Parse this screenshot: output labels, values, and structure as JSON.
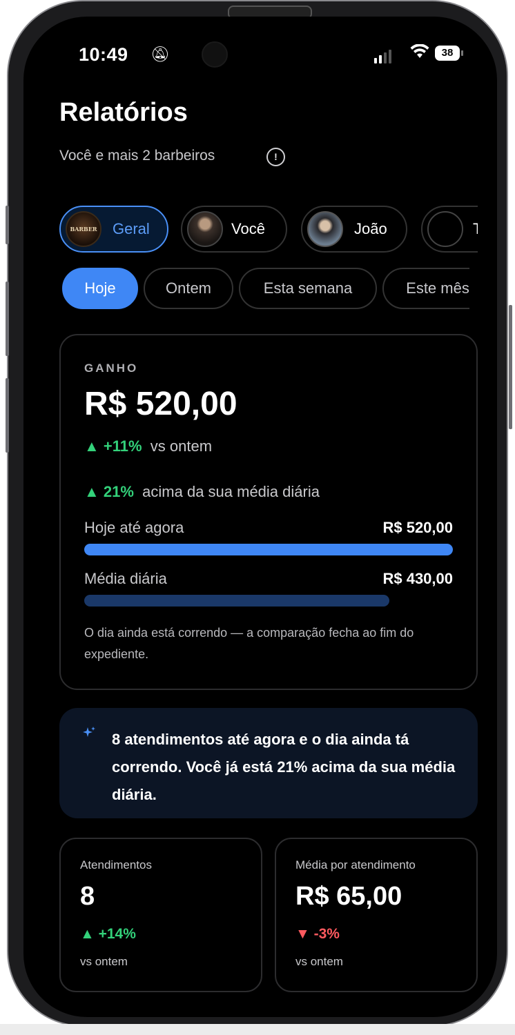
{
  "status_bar": {
    "time": "10:49",
    "battery": "38"
  },
  "page": {
    "title": "Relatórios",
    "subtitle": "Você e mais 2 barbeiros",
    "info_icon": "!"
  },
  "barbers": [
    {
      "label": "Geral",
      "avatar_text": "BARBER",
      "active": true
    },
    {
      "label": "Você",
      "active": false
    },
    {
      "label": "João",
      "active": false
    },
    {
      "label": "T",
      "active": false
    }
  ],
  "periods": [
    {
      "label": "Hoje",
      "active": true
    },
    {
      "label": "Ontem",
      "active": false
    },
    {
      "label": "Esta semana",
      "active": false
    },
    {
      "label": "Este mês",
      "active": false
    }
  ],
  "earnings": {
    "eyebrow": "GANHO",
    "amount": "R$ 520,00",
    "delta_value": "▲ +11%",
    "delta_text": "vs ontem",
    "avg_delta_value": "▲ 21%",
    "avg_delta_text": "acima da sua média diária",
    "today_label": "Hoje até agora",
    "today_value": "R$ 520,00",
    "today_fraction": 1.0,
    "average_label": "Média diária",
    "average_value": "R$ 430,00",
    "average_fraction": 0.827,
    "note": "O dia ainda está correndo — a comparação fecha ao fim do expediente."
  },
  "insight": {
    "icon": "sparkle-icon",
    "text": "8 atendimentos até agora e o dia ainda tá correndo. Você já está 21% acima da sua média diária."
  },
  "stats": [
    {
      "label": "Atendimentos",
      "value": "8",
      "delta": "▲ +14%",
      "sub": "vs ontem"
    },
    {
      "label": "Média por atendimento",
      "value": "R$ 65,00",
      "delta": "▼ -3%",
      "sub": "vs ontem"
    }
  ],
  "colors": {
    "accent": "#3f87f5",
    "positive": "#33d17a",
    "negative": "#ff5a5f",
    "background": "#000000"
  }
}
